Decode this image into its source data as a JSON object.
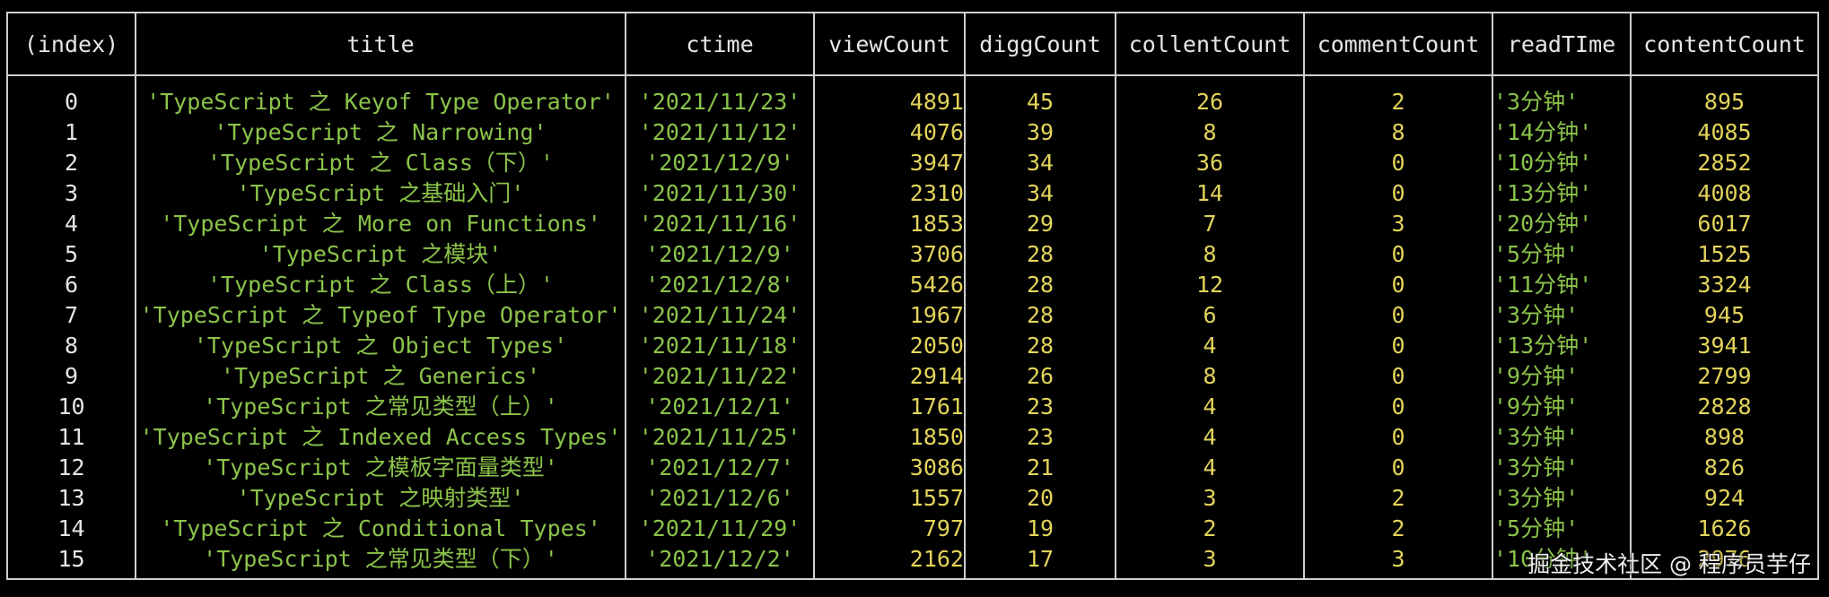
{
  "colors": {
    "background": "#000000",
    "header_text": "#e6e6e6",
    "index_text": "#e6e6e6",
    "string_value": "#8bc34a",
    "number_value": "#e2d45a",
    "grid_line": "#cfcfcf"
  },
  "table": {
    "headers": [
      "(index)",
      "title",
      "ctime",
      "viewCount",
      "diggCount",
      "collentCount",
      "commentCount",
      "readTIme",
      "contentCount"
    ],
    "rows": [
      {
        "index": "0",
        "title": "'TypeScript 之 Keyof Type Operator'",
        "ctime": "'2021/11/23'",
        "viewCount": "4891",
        "diggCount": "45",
        "collentCount": "26",
        "commentCount": "2",
        "readTime": "'3分钟'",
        "contentCount": "895"
      },
      {
        "index": "1",
        "title": "'TypeScript 之 Narrowing'",
        "ctime": "'2021/11/12'",
        "viewCount": "4076",
        "diggCount": "39",
        "collentCount": "8",
        "commentCount": "8",
        "readTime": "'14分钟'",
        "contentCount": "4085"
      },
      {
        "index": "2",
        "title": "'TypeScript 之 Class（下）'",
        "ctime": "'2021/12/9'",
        "viewCount": "3947",
        "diggCount": "34",
        "collentCount": "36",
        "commentCount": "0",
        "readTime": "'10分钟'",
        "contentCount": "2852"
      },
      {
        "index": "3",
        "title": "'TypeScript 之基础入门'",
        "ctime": "'2021/11/30'",
        "viewCount": "2310",
        "diggCount": "34",
        "collentCount": "14",
        "commentCount": "0",
        "readTime": "'13分钟'",
        "contentCount": "4008"
      },
      {
        "index": "4",
        "title": "'TypeScript 之 More on Functions'",
        "ctime": "'2021/11/16'",
        "viewCount": "1853",
        "diggCount": "29",
        "collentCount": "7",
        "commentCount": "3",
        "readTime": "'20分钟'",
        "contentCount": "6017"
      },
      {
        "index": "5",
        "title": "'TypeScript 之模块'",
        "ctime": "'2021/12/9'",
        "viewCount": "3706",
        "diggCount": "28",
        "collentCount": "8",
        "commentCount": "0",
        "readTime": "'5分钟'",
        "contentCount": "1525"
      },
      {
        "index": "6",
        "title": "'TypeScript 之 Class（上）'",
        "ctime": "'2021/12/8'",
        "viewCount": "5426",
        "diggCount": "28",
        "collentCount": "12",
        "commentCount": "0",
        "readTime": "'11分钟'",
        "contentCount": "3324"
      },
      {
        "index": "7",
        "title": "'TypeScript 之 Typeof Type Operator'",
        "ctime": "'2021/11/24'",
        "viewCount": "1967",
        "diggCount": "28",
        "collentCount": "6",
        "commentCount": "0",
        "readTime": "'3分钟'",
        "contentCount": "945"
      },
      {
        "index": "8",
        "title": "'TypeScript 之 Object Types'",
        "ctime": "'2021/11/18'",
        "viewCount": "2050",
        "diggCount": "28",
        "collentCount": "4",
        "commentCount": "0",
        "readTime": "'13分钟'",
        "contentCount": "3941"
      },
      {
        "index": "9",
        "title": "'TypeScript 之 Generics'",
        "ctime": "'2021/11/22'",
        "viewCount": "2914",
        "diggCount": "26",
        "collentCount": "8",
        "commentCount": "0",
        "readTime": "'9分钟'",
        "contentCount": "2799"
      },
      {
        "index": "10",
        "title": "'TypeScript 之常见类型（上）'",
        "ctime": "'2021/12/1'",
        "viewCount": "1761",
        "diggCount": "23",
        "collentCount": "4",
        "commentCount": "0",
        "readTime": "'9分钟'",
        "contentCount": "2828"
      },
      {
        "index": "11",
        "title": "'TypeScript 之 Indexed Access Types'",
        "ctime": "'2021/11/25'",
        "viewCount": "1850",
        "diggCount": "23",
        "collentCount": "4",
        "commentCount": "0",
        "readTime": "'3分钟'",
        "contentCount": "898"
      },
      {
        "index": "12",
        "title": "'TypeScript 之模板字面量类型'",
        "ctime": "'2021/12/7'",
        "viewCount": "3086",
        "diggCount": "21",
        "collentCount": "4",
        "commentCount": "0",
        "readTime": "'3分钟'",
        "contentCount": "826"
      },
      {
        "index": "13",
        "title": "'TypeScript 之映射类型'",
        "ctime": "'2021/12/6'",
        "viewCount": "1557",
        "diggCount": "20",
        "collentCount": "3",
        "commentCount": "2",
        "readTime": "'3分钟'",
        "contentCount": "924"
      },
      {
        "index": "14",
        "title": "'TypeScript 之 Conditional Types'",
        "ctime": "'2021/11/29'",
        "viewCount": "797",
        "diggCount": "19",
        "collentCount": "2",
        "commentCount": "2",
        "readTime": "'5分钟'",
        "contentCount": "1626"
      },
      {
        "index": "15",
        "title": "'TypeScript 之常见类型（下）'",
        "ctime": "'2021/12/2'",
        "viewCount": "2162",
        "diggCount": "17",
        "collentCount": "3",
        "commentCount": "3",
        "readTime": "'10分钟'",
        "contentCount": "2976"
      }
    ]
  },
  "watermark": "掘金技术社区 @ 程序员芋仔"
}
